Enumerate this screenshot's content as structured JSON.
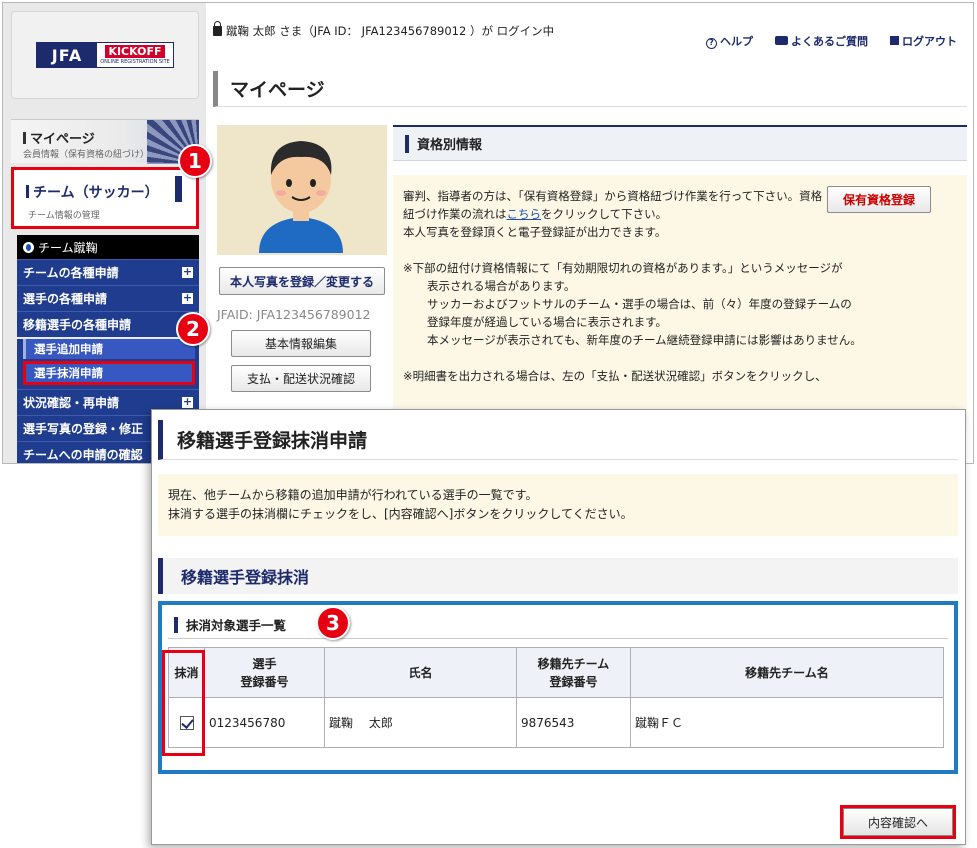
{
  "user_bar": {
    "login_text": "蹴鞠 太郎 さま（JFA ID： JFA123456789012 ）が ログイン中"
  },
  "logo": {
    "jfa": "JFA",
    "kickoff": "KICKOFF",
    "kickoff_sub": "ONLINE REGISTRATION SITE"
  },
  "header_links": {
    "help": "ヘルプ",
    "faq": "よくあるご質問",
    "logout": "ログアウト"
  },
  "page_title": "マイページ",
  "sidebar": {
    "mypage": {
      "label": "マイページ",
      "sub": "会員情報（保有資格の紐づけ）"
    },
    "team": {
      "label": "チーム（サッカー）",
      "sub": "チーム情報の管理"
    },
    "menu_head": "チーム蹴鞠",
    "menu": [
      {
        "label": "チームの各種申請"
      },
      {
        "label": "選手の各種申請"
      },
      {
        "label": "移籍選手の各種申請"
      },
      {
        "label": "状況確認・再申請"
      },
      {
        "label": "選手写真の登録・修正"
      },
      {
        "label": "チームへの申請の確認"
      }
    ],
    "submenu": [
      {
        "label": "選手追加申請"
      },
      {
        "label": "選手抹消申請"
      }
    ]
  },
  "markers": {
    "m1": "1",
    "m2": "2",
    "m3": "3"
  },
  "profile": {
    "photo_button": "本人写真を登録／変更する",
    "jfaid": "JFAID: JFA123456789012",
    "basic_button": "基本情報編集",
    "payment_button": "支払・配送状況確認"
  },
  "qualification": {
    "heading": "資格別情報",
    "register_button": "保有資格登録",
    "p1_a": "審判、指導者の方は、「保有資格登録」から資格紐づけ作業を行って下さい。資格紐づけ作業の流れは",
    "p1_link": "こちら",
    "p1_b": "をクリックして下さい。",
    "p2": "本人写真を登録頂くと電子登録証が出力できます。",
    "note1": "※下部の紐付け資格情報にて「有効期限切れの資格があります。」というメッセージが",
    "note1_l2": "表示される場合があります。",
    "note1_l3": "サッカーおよびフットサルのチーム・選手の場合は、前（々）年度の登録チームの",
    "note1_l4": "登録年度が経過している場合に表示されます。",
    "note1_l5": "本メッセージが表示されても、新年度のチーム継続登録申請には影響はありません。",
    "note2": "※明細書を出力される場合は、左の「支払・配送状況確認」ボタンをクリックし、"
  },
  "overlay": {
    "title": "移籍選手登録抹消申請",
    "info_l1": "現在、他チームから移籍の追加申請が行われている選手の一覧です。",
    "info_l2": "抹消する選手の抹消欄にチェックをし、[内容確認へ]ボタンをクリックしてください。",
    "section": "移籍選手登録抹消",
    "subsection": "抹消対象選手一覧",
    "columns": [
      "抹消",
      "選手\n登録番号",
      "氏名",
      "移籍先チーム\n登録番号",
      "移籍先チーム名"
    ],
    "rows": [
      {
        "checked": true,
        "player_no": "0123456780",
        "name": "蹴鞠　 太郎",
        "team_no": "9876543",
        "team_name": "蹴鞠ＦＣ"
      }
    ],
    "confirm_button": "内容確認へ"
  }
}
